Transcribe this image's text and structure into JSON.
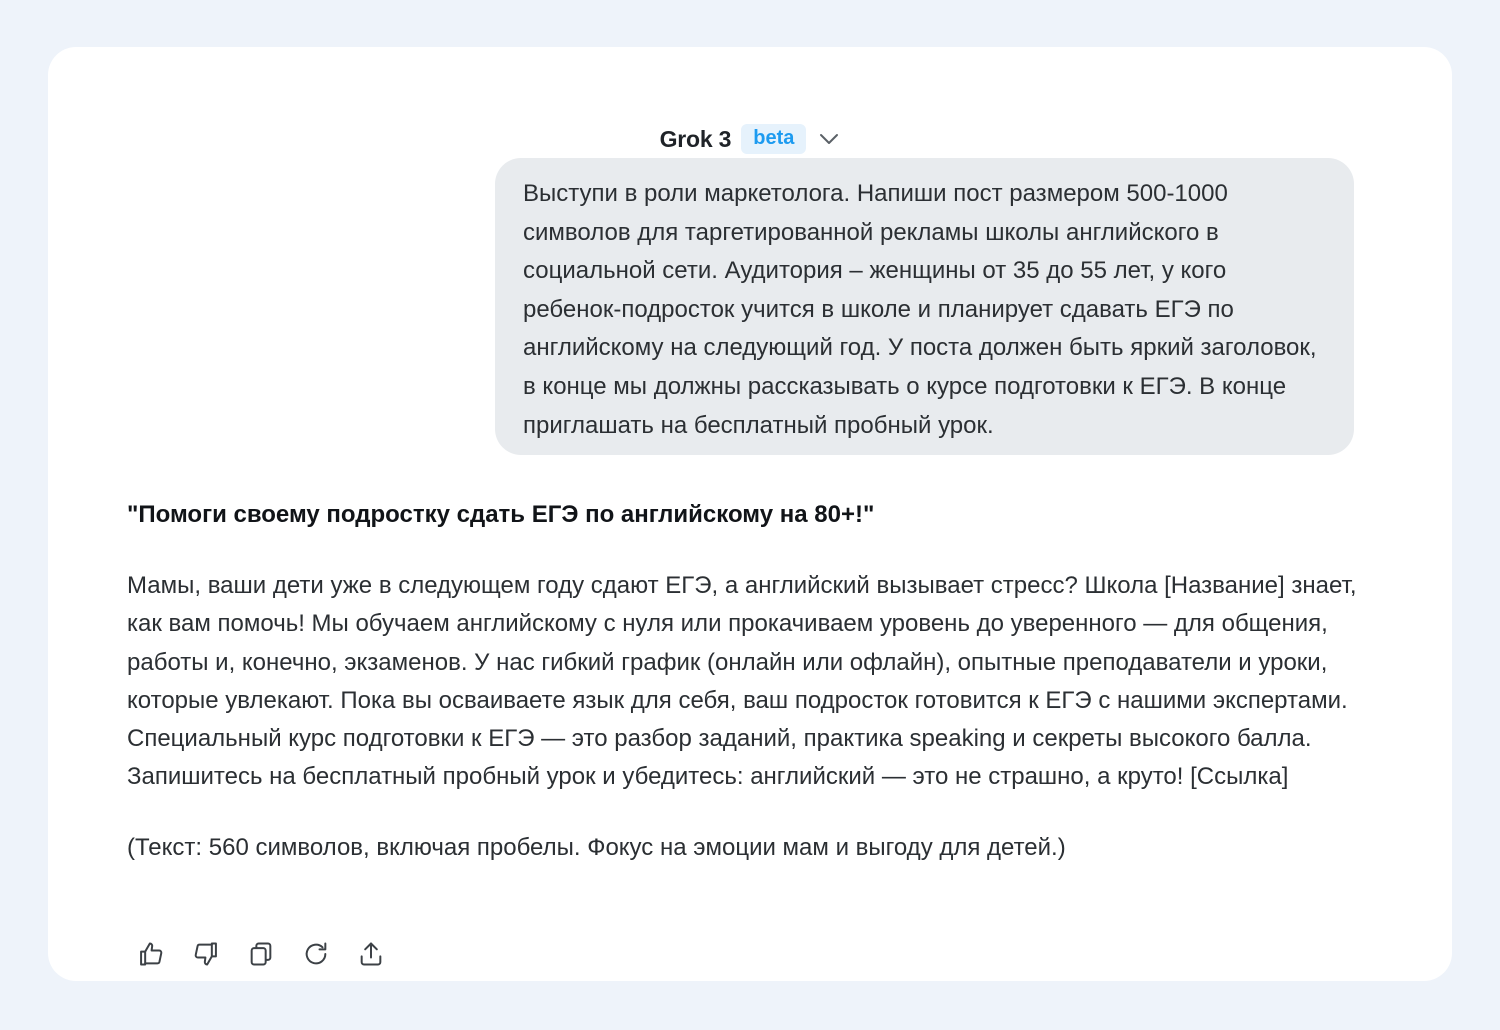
{
  "header": {
    "model_name": "Grok 3",
    "badge": "beta"
  },
  "user_message": {
    "text": "Выступи в роли маркетолога. Напиши пост размером 500-1000 символов для таргетированной рекламы школы английского в социальной сети. Аудитория – женщины от 35 до 55 лет, у кого ребенок-подросток учится в школе и планирует сдавать ЕГЭ по английскому на следующий год. У поста должен быть яркий заголовок, в конце мы должны рассказывать о курсе подготовки к ЕГЭ. В конце приглашать на бесплатный пробный урок."
  },
  "assistant_message": {
    "title": "\"Помоги своему подростку сдать ЕГЭ по английскому на 80+!\"",
    "body": "Мамы, ваши дети уже в следующем году сдают ЕГЭ, а английский вызывает стресс? Школа [Название] знает, как вам помочь! Мы обучаем английскому с нуля или прокачиваем уровень до уверенного — для общения, работы и, конечно, экзаменов. У нас гибкий график (онлайн или офлайн), опытные преподаватели и уроки, которые увлекают. Пока вы осваиваете язык для себя, ваш подросток готовится к ЕГЭ с нашими экспертами. Специальный курс подготовки к ЕГЭ — это разбор заданий, практика speaking и секреты высокого балла. Запишитесь на бесплатный пробный урок и убедитесь: английский — это не страшно, а круто! [Ссылка]",
    "note": "(Текст: 560 символов, включая пробелы. Фокус на эмоции мам и выгоду для детей.)"
  },
  "actions": [
    {
      "icon": "thumbs-up-icon"
    },
    {
      "icon": "thumbs-down-icon"
    },
    {
      "icon": "copy-icon"
    },
    {
      "icon": "regenerate-icon"
    },
    {
      "icon": "share-icon"
    }
  ],
  "colors": {
    "page_background": "#eef3fa",
    "card_background": "#ffffff",
    "user_bubble": "#e8ebee",
    "badge_text": "#1d9bf0",
    "badge_background": "#e6f2fc",
    "text": "#2b2f33",
    "icon": "#3c4146"
  }
}
